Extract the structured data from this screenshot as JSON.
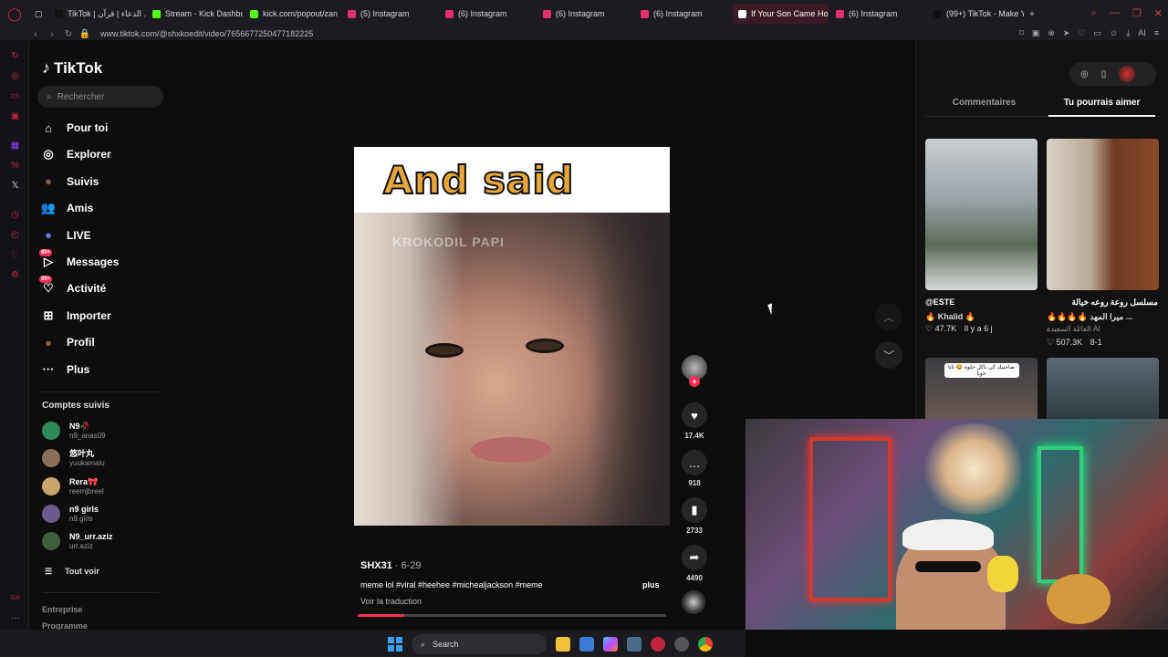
{
  "browser": {
    "tabs": [
      {
        "label": "TikTok | ورد الدعاء | قرآن",
        "color": "#111111",
        "active": false
      },
      {
        "label": "Stream - Kick Dashbo",
        "color": "#53fc18",
        "active": false
      },
      {
        "label": "kick.com/popout/zan",
        "color": "#53fc18",
        "active": false
      },
      {
        "label": "(5) Instagram",
        "color": "#e1306c",
        "active": false
      },
      {
        "label": "(6) Instagram",
        "color": "#e1306c",
        "active": false
      },
      {
        "label": "(6) Instagram",
        "color": "#e1306c",
        "active": false
      },
      {
        "label": "(6) Instagram",
        "color": "#e1306c",
        "active": false
      },
      {
        "label": "If Your Son Came Hom",
        "color": "#ffffff",
        "active": true
      },
      {
        "label": "(6) Instagram",
        "color": "#e1306c",
        "active": false
      },
      {
        "label": "(99+) TikTok - Make Y",
        "color": "#111111",
        "active": false
      }
    ],
    "url": "www.tiktok.com/@shxkoedit/video/7656677250477182225",
    "ai_label": "AI"
  },
  "tiktok": {
    "logo_text": "TikTok",
    "search_placeholder": "Rechercher",
    "nav": [
      {
        "label": "Pour toi",
        "icon": "home-icon",
        "glyph": "⌂"
      },
      {
        "label": "Explorer",
        "icon": "compass-icon",
        "glyph": "◎"
      },
      {
        "label": "Suivis",
        "icon": "following-icon",
        "glyph": "●"
      },
      {
        "label": "Amis",
        "icon": "friends-icon",
        "glyph": "👥"
      },
      {
        "label": "LIVE",
        "icon": "live-icon",
        "glyph": "●"
      },
      {
        "label": "Messages",
        "icon": "messages-icon",
        "glyph": "▷",
        "badge": "99+"
      },
      {
        "label": "Activité",
        "icon": "activity-icon",
        "glyph": "♡",
        "badge": "99+"
      },
      {
        "label": "Importer",
        "icon": "upload-icon",
        "glyph": "⊞"
      },
      {
        "label": "Profil",
        "icon": "profile-icon",
        "glyph": "●"
      },
      {
        "label": "Plus",
        "icon": "more-icon",
        "glyph": "···"
      }
    ],
    "following_title": "Comptes suivis",
    "accounts": [
      {
        "name": "N9🥀",
        "handle": "n9_anas09",
        "color": "#2e8b57"
      },
      {
        "name": "悠叶丸",
        "handle": "yuukamalu",
        "color": "#8a6f5a"
      },
      {
        "name": "Rera🎀",
        "handle": "reemjbreel",
        "color": "#c9a56b"
      },
      {
        "name": "n9 girls",
        "handle": "n9.girls",
        "color": "#6c5a8c"
      },
      {
        "name": "N9_urr.aziz",
        "handle": "urr.aziz",
        "color": "#3e5e3e"
      }
    ],
    "see_all": "Tout voir",
    "footer": [
      "Entreprise",
      "Programme"
    ]
  },
  "video": {
    "caption_text": "And said",
    "watermark": "KROKODIL PAPI",
    "author": "SHX31",
    "date": "· 6-29",
    "description": "meme lol #viral #heehee #michealjackson #meme",
    "more": "plus",
    "translate": "Voir la traduction",
    "progress": 0.15,
    "likes": "17.4K",
    "comments": "918",
    "saves": "2733",
    "shares": "4490"
  },
  "right_panel": {
    "tabs": [
      "Commentaires",
      "Tu pourrais aimer"
    ],
    "active_tab": 1,
    "cards": [
      {
        "title": "@ESTE",
        "subtitle": "🔥 Khalid 🔥",
        "likes": "47.7K",
        "time": "Il y a 6 j"
      },
      {
        "title": "مسلسل روعة روعه خيالة",
        "subtitle": "... ميرا المهد 🔥🔥🔥🔥",
        "channel": "العائلة السعيدة AI",
        "likes": "507.3K",
        "time": "8-1"
      }
    ],
    "small_card_text": "صاحبيك كي ياكل حلوة 😂 تاتا خويا"
  },
  "taskbar": {
    "search_label": "Search"
  }
}
